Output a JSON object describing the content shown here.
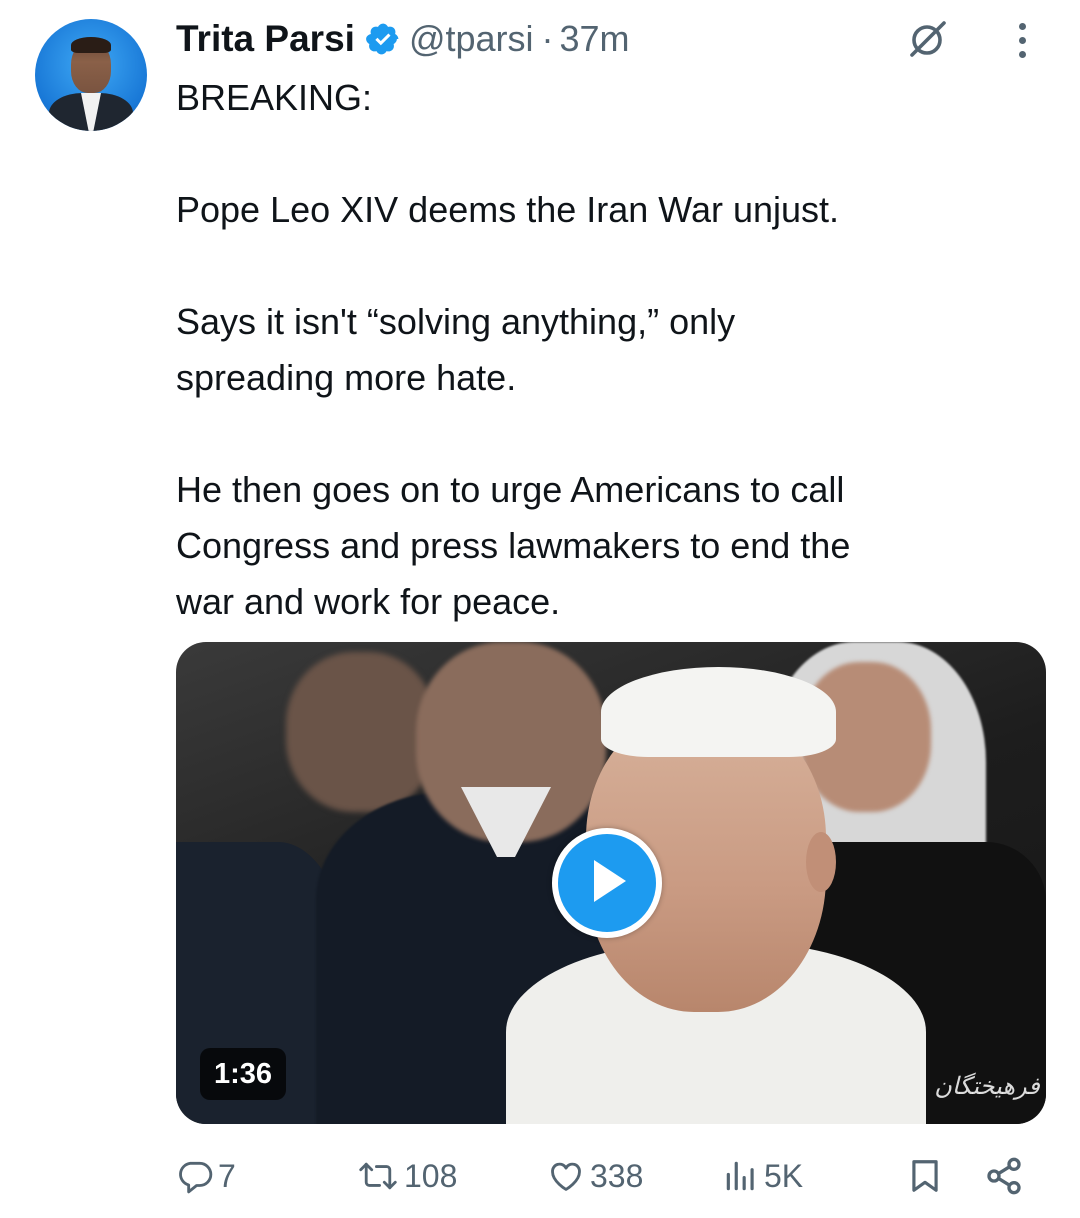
{
  "author": {
    "name": "Trita Parsi",
    "handle": "@tparsi",
    "separator": "·",
    "time": "37m",
    "verified": true
  },
  "icons": {
    "verified": "verified-badge-icon",
    "grok": "grok-icon",
    "more": "more-options-icon"
  },
  "tweet": {
    "text": "BREAKING:\n\nPope Leo XIV deems the Iran War unjust.\n\nSays it isn't “solving anything,” only\nspreading more hate.\n\nHe then goes on to urge Americans to call\nCongress and press lawmakers to end the\nwar and work for peace."
  },
  "video": {
    "duration": "1:36",
    "watermark": "فرهیختگان"
  },
  "actions": {
    "replies": "7",
    "reposts": "108",
    "likes": "338",
    "views": "5K"
  },
  "colors": {
    "accent": "#1d9bf0",
    "text": "#0f1419",
    "secondary": "#536471"
  }
}
